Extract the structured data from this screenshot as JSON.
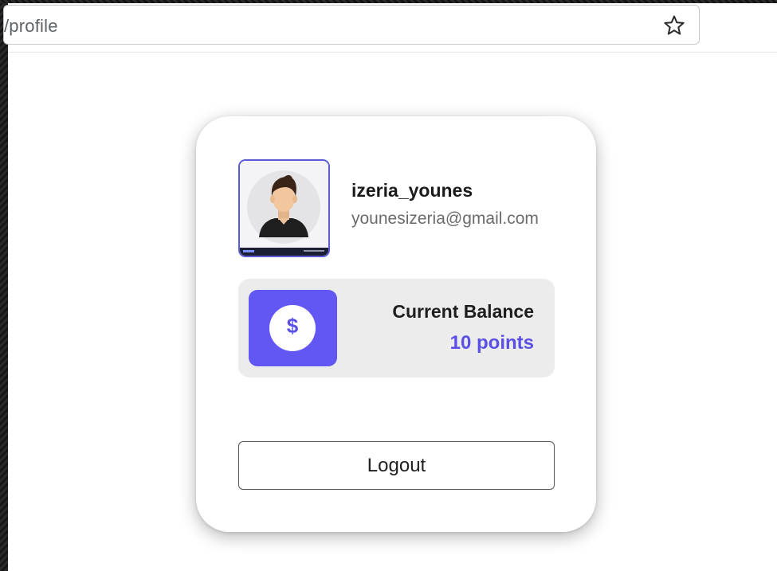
{
  "browser": {
    "url_text": "/profile",
    "star_icon": "bookmark-star-icon"
  },
  "profile": {
    "avatar_icon": "user-avatar-image",
    "username": "izeria_younes",
    "email": "younesizeria@gmail.com"
  },
  "balance": {
    "icon": "dollar-coin-icon",
    "title": "Current Balance",
    "value": "10 points"
  },
  "actions": {
    "logout_label": "Logout"
  },
  "colors": {
    "accent": "#6257f2",
    "accent_text": "#5b50e6",
    "panel_bg": "#ececec"
  }
}
